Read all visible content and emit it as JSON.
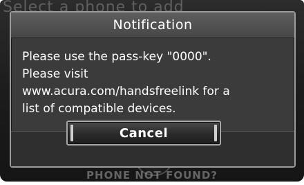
{
  "background": {
    "title": "Select a phone to add",
    "footer": "PHONE NOT FOUND?"
  },
  "dialog": {
    "title": "Notification",
    "message": "Please use the pass-key \"0000\".\nPlease visit\nwww.acura.com/handsfreelink for a\nlist of compatible devices.",
    "cancel_label": "Cancel"
  },
  "colors": {
    "dialog_background": "#3b3b3b",
    "header_background": "#545454",
    "text": "#ffffff",
    "border": "#9c9c9c"
  }
}
